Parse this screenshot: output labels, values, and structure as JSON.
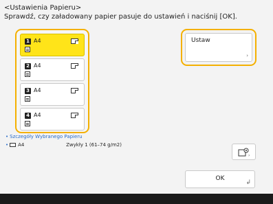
{
  "header": {
    "title": "<Ustawienia Papieru>",
    "instruction": "Sprawdź, czy załadowany papier pasuje do ustawień i naciśnij [OK]."
  },
  "drawers": [
    {
      "num": "1",
      "size": "A4",
      "selected": true
    },
    {
      "num": "2",
      "size": "A4",
      "selected": false
    },
    {
      "num": "3",
      "size": "A4",
      "selected": false
    },
    {
      "num": "4",
      "size": "A4",
      "selected": false
    }
  ],
  "set_button": {
    "label": "Ustaw"
  },
  "details": {
    "label": "Szczegóły Wybranego Papieru",
    "paper_size": "A4",
    "paper_type": "Zwykły 1 (61–74 g/m2)"
  },
  "ok_button": {
    "label": "OK"
  },
  "colors": {
    "selected": "#ffe419",
    "highlight_frame": "#f4b000",
    "accent_blue": "#2a6cc8"
  }
}
